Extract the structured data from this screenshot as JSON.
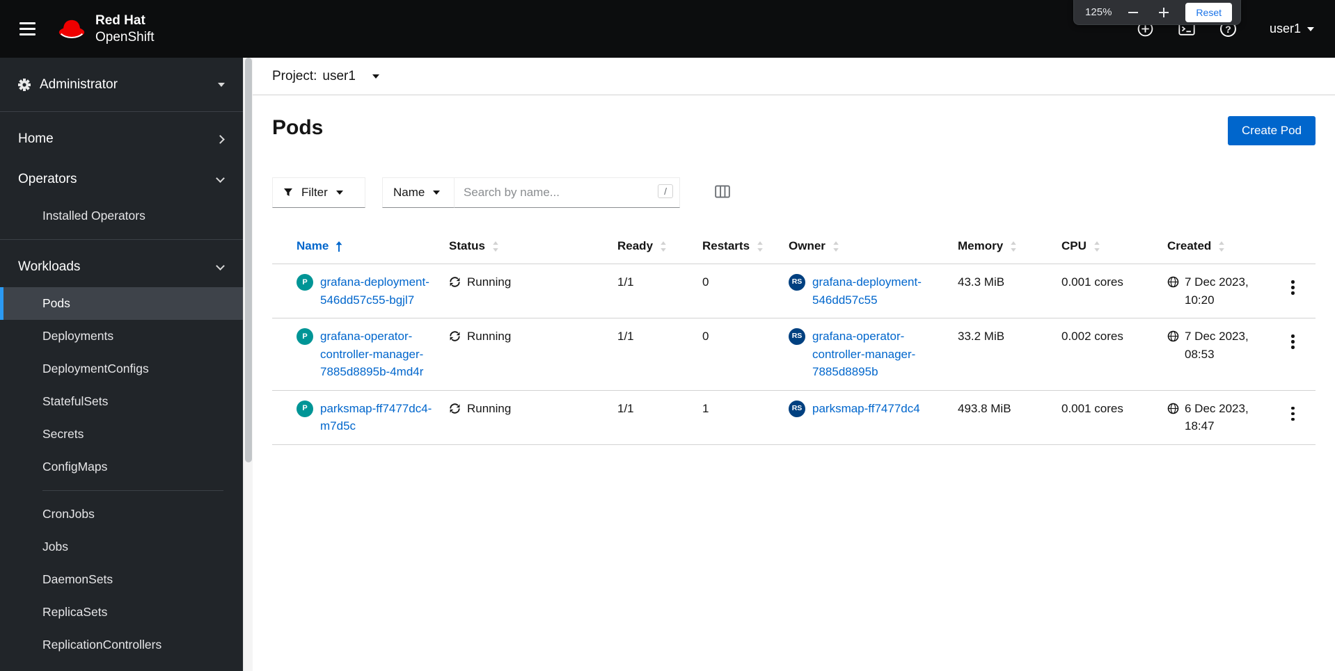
{
  "colors": {
    "accent": "#0066cc",
    "masthead_bg": "#0c0d0e",
    "sidebar_bg": "#212529",
    "active_nav_border": "#2b9af3",
    "pod_badge": "#009596",
    "replicaset_badge": "#004080"
  },
  "masthead": {
    "brand": {
      "line1": "Red Hat",
      "line2": "OpenShift"
    },
    "zoom_popup": {
      "level": "125%",
      "reset_label": "Reset"
    },
    "icons": {
      "help_glyph": "?"
    },
    "username": "user1"
  },
  "sidebar": {
    "perspective": "Administrator",
    "groups": {
      "home": "Home",
      "operators": "Operators",
      "workloads": "Workloads"
    },
    "operators_items": [
      "Installed Operators"
    ],
    "workloads_items": [
      "Pods",
      "Deployments",
      "DeploymentConfigs",
      "StatefulSets",
      "Secrets",
      "ConfigMaps",
      "CronJobs",
      "Jobs",
      "DaemonSets",
      "ReplicaSets",
      "ReplicationControllers"
    ],
    "active_item": "Pods"
  },
  "project_bar": {
    "label": "Project:",
    "value": "user1"
  },
  "page": {
    "title": "Pods",
    "create_button_label": "Create Pod"
  },
  "toolbar": {
    "filter_label": "Filter",
    "attribute_selected": "Name",
    "search_placeholder": "Search by name...",
    "shortcut_hint": "/"
  },
  "table": {
    "columns": [
      "Name",
      "Status",
      "Ready",
      "Restarts",
      "Owner",
      "Memory",
      "CPU",
      "Created"
    ],
    "sorted_by": "Name",
    "sort_direction": "ascending",
    "rows": [
      {
        "badge": "P",
        "name": "grafana-deployment-546dd57c55-bgjl7",
        "status": "Running",
        "ready": "1/1",
        "restarts": "0",
        "owner_badge": "RS",
        "owner": "grafana-deployment-546dd57c55",
        "memory": "43.3 MiB",
        "cpu": "0.001 cores",
        "created": "7 Dec 2023, 10:20"
      },
      {
        "badge": "P",
        "name": "grafana-operator-controller-manager-7885d8895b-4md4r",
        "status": "Running",
        "ready": "1/1",
        "restarts": "0",
        "owner_badge": "RS",
        "owner": "grafana-operator-controller-manager-7885d8895b",
        "memory": "33.2 MiB",
        "cpu": "0.002 cores",
        "created": "7 Dec 2023, 08:53"
      },
      {
        "badge": "P",
        "name": "parksmap-ff7477dc4-m7d5c",
        "status": "Running",
        "ready": "1/1",
        "restarts": "1",
        "owner_badge": "RS",
        "owner": "parksmap-ff7477dc4",
        "memory": "493.8 MiB",
        "cpu": "0.001 cores",
        "created": "6 Dec 2023, 18:47"
      }
    ]
  }
}
